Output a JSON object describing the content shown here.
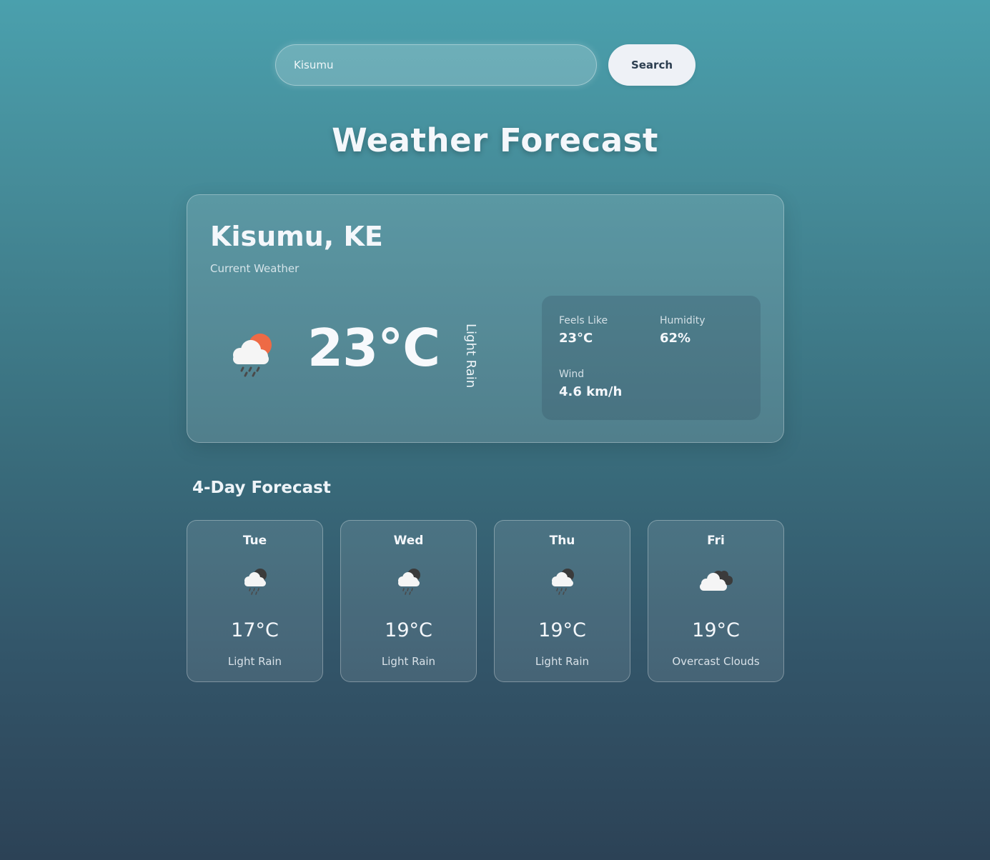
{
  "search": {
    "value": "Kisumu",
    "button_label": "Search"
  },
  "title": "Weather Forecast",
  "current": {
    "location": "Kisumu, KE",
    "subtitle": "Current Weather",
    "icon": "cloud-rain-sun-icon",
    "temperature": "23°C",
    "description": "Light Rain",
    "details": {
      "feels_like_label": "Feels Like",
      "feels_like_value": "23°C",
      "humidity_label": "Humidity",
      "humidity_value": "62%",
      "wind_label": "Wind",
      "wind_value": "4.6 km/h"
    }
  },
  "forecast": {
    "heading": "4-Day Forecast",
    "days": [
      {
        "day": "Tue",
        "icon": "cloud-rain-moon-icon",
        "temp": "17°C",
        "desc": "Light Rain"
      },
      {
        "day": "Wed",
        "icon": "cloud-rain-moon-icon",
        "temp": "19°C",
        "desc": "Light Rain"
      },
      {
        "day": "Thu",
        "icon": "cloud-rain-moon-icon",
        "temp": "19°C",
        "desc": "Light Rain"
      },
      {
        "day": "Fri",
        "icon": "overcast-clouds-icon",
        "temp": "19°C",
        "desc": "Overcast Clouds"
      }
    ]
  },
  "colors": {
    "sun": "#ee6a45",
    "moon": "#3b3b3b",
    "cloud": "#f5f5f5",
    "rain": "#4a4a4a",
    "button_bg": "#eef1f6",
    "button_text": "#2c3e50"
  }
}
